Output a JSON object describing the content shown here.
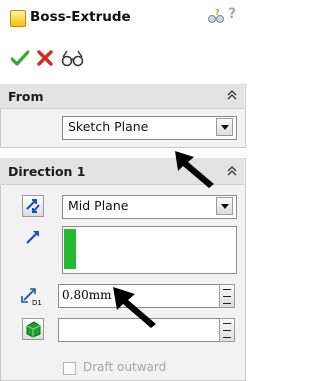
{
  "window": {
    "title": "Boss-Extrude",
    "title_icon": "feature-icon",
    "help_icon": "help-glasses-icon",
    "help_text": "?"
  },
  "actions": {
    "ok_icon": "checkmark-icon",
    "cancel_icon": "x-icon",
    "preview_icon": "detailed-preview-icon"
  },
  "from": {
    "title": "From",
    "collapse_icon": "chevron-up-icon",
    "start_condition": "Sketch Plane"
  },
  "direction1": {
    "title": "Direction 1",
    "collapse_icon": "chevron-up-icon",
    "end_condition": "Mid Plane",
    "depth_value": "0.80mm",
    "depth_label": "D1",
    "draft_value": "",
    "draft_outward_label": "Draft outward",
    "draft_outward_checked": false
  },
  "colors": {
    "selection_highlight": "#22bb33",
    "ok_green": "#3aa534",
    "cancel_red": "#d42a1c",
    "annotation_arrow": "#000000"
  }
}
